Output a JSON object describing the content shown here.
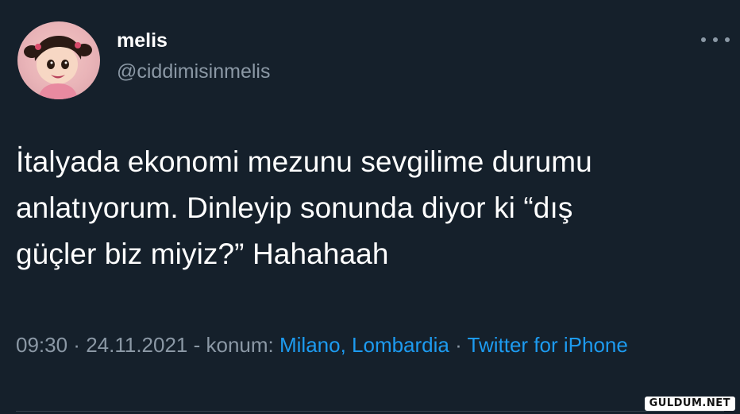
{
  "tweet": {
    "author": {
      "display_name": "melis",
      "handle": "@ciddimisinmelis"
    },
    "text": "İtalyada ekonomi mezunu sevgilime durumu\nanlatıyorum. Dinleyip sonunda diyor ki “dış\ngüçler biz miyiz?” Hahahaah",
    "meta": {
      "time": "09:30",
      "sep1": " · ",
      "date": "24.11.2021",
      "location_prefix": " - konum: ",
      "location": "Milano, Lombardia",
      "sep2": " · ",
      "source": "Twitter for iPhone"
    }
  },
  "watermark": {
    "text": "GULDUM.NET"
  },
  "colors": {
    "background": "#15202b",
    "text": "#ffffff",
    "secondary": "#8b98a5",
    "link": "#1d9bf0"
  },
  "icons": {
    "more": "more-horizontal-icon",
    "avatar": "avatar-image"
  }
}
